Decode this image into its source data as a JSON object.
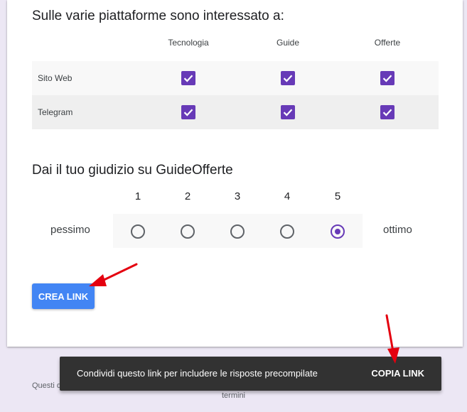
{
  "colors": {
    "accent": "#673ab7",
    "button": "#4285f4",
    "annotation_arrow": "#e4000f",
    "snackbar": "#323232"
  },
  "grid_question": {
    "title": "Sulle varie piattaforme sono interessato a:",
    "columns": [
      "Tecnologia",
      "Guide",
      "Offerte"
    ],
    "rows": [
      {
        "label": "Sito Web",
        "checked": [
          true,
          true,
          true
        ]
      },
      {
        "label": "Telegram",
        "checked": [
          true,
          true,
          true
        ]
      }
    ]
  },
  "scale_question": {
    "title": "Dai il tuo giudizio su GuideOfferte",
    "options": [
      "1",
      "2",
      "3",
      "4",
      "5"
    ],
    "selected": "5",
    "low_label": "pessimo",
    "high_label": "ottimo"
  },
  "create_link_button": "CREA LINK",
  "footer": {
    "text_visible": "Questi d",
    "link": "termini"
  },
  "snackbar": {
    "message": "Condividi questo link per includere le risposte precompilate",
    "action": "COPIA LINK"
  }
}
